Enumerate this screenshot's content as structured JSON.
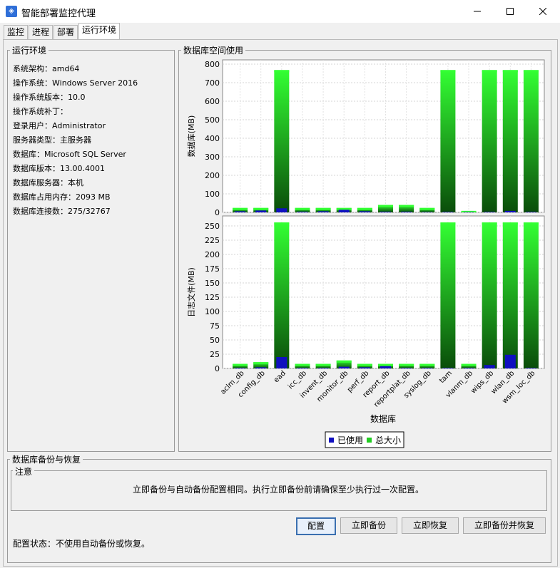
{
  "window": {
    "title": "智能部署监控代理"
  },
  "tabs": [
    "监控",
    "进程",
    "部署",
    "运行环境"
  ],
  "env": {
    "title": "运行环境",
    "lines": [
      "系统架构：amd64",
      "操作系统：Windows Server 2016",
      "操作系统版本：10.0",
      "操作系统补丁：",
      "登录用户：Administrator",
      "服务器类型：主服务器",
      "数据库：Microsoft SQL Server",
      "数据库版本：13.00.4001",
      "数据库服务器：本机",
      "数据库占用内存：2093 MB",
      "数据库连接数：275/32767"
    ]
  },
  "db_panel": {
    "title": "数据库空间使用"
  },
  "backup": {
    "title": "数据库备份与恢复",
    "notice_title": "注意",
    "notice_text": "立即备份与自动备份配置相同。执行立即备份前请确保至少执行过一次配置。",
    "buttons": [
      "配置",
      "立即备份",
      "立即恢复",
      "立即备份并恢复"
    ],
    "status": "配置状态：不使用自动备份或恢复。"
  },
  "colors": {
    "used": "#1010c0",
    "total_top": "#33ff33",
    "total_bottom": "#0a4d0a"
  },
  "chart_data": {
    "type": "bar",
    "categories": [
      "aclm_db",
      "config_db",
      "ead",
      "icc_db",
      "invent_db",
      "monitor_db",
      "perf_db",
      "report_db",
      "reportplat_db",
      "syslog_db",
      "tam",
      "vlanm_db",
      "wips_db",
      "wlan_db",
      "wsm_loc_db"
    ],
    "xlabel": "数据库",
    "legend": [
      "已使用",
      "总大小"
    ],
    "legend_position": "bottom-center",
    "grid": true,
    "panels": [
      {
        "ylabel": "数据库(MB)",
        "ylim": [
          0,
          800
        ],
        "yticks": [
          0,
          100,
          200,
          300,
          400,
          500,
          600,
          700,
          800
        ],
        "series": [
          {
            "name": "总大小",
            "values": [
              24,
              24,
              768,
              24,
              24,
              24,
              24,
              40,
              40,
              24,
              768,
              8,
              768,
              768,
              768
            ]
          },
          {
            "name": "已使用",
            "values": [
              6,
              10,
              22,
              4,
              6,
              14,
              6,
              4,
              4,
              2,
              3,
              2,
              3,
              8,
              3
            ]
          }
        ]
      },
      {
        "ylabel": "日志文件(MB)",
        "ylim": [
          0,
          260
        ],
        "yticks": [
          0,
          25,
          50,
          75,
          100,
          125,
          150,
          175,
          200,
          225,
          250
        ],
        "series": [
          {
            "name": "总大小",
            "values": [
              8,
              11,
              256,
              8,
              8,
              14,
              8,
              8,
              8,
              8,
              256,
              8,
              256,
              256,
              256
            ]
          },
          {
            "name": "已使用",
            "values": [
              1,
              2,
              20,
              1,
              1,
              3,
              2,
              4,
              1,
              1,
              1,
              1,
              6,
              24,
              1
            ]
          }
        ]
      }
    ]
  }
}
